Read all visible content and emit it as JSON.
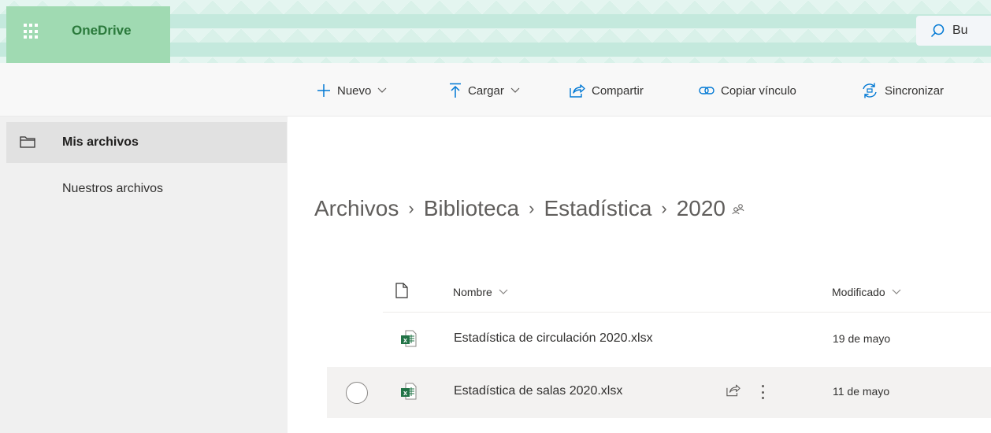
{
  "header": {
    "app_name": "OneDrive",
    "search_label": "Bu"
  },
  "toolbar": {
    "new_label": "Nuevo",
    "upload_label": "Cargar",
    "share_label": "Compartir",
    "copy_link_label": "Copiar vínculo",
    "sync_label": "Sincronizar"
  },
  "sidebar": {
    "items": [
      {
        "label": "Mis archivos",
        "icon": "folder-icon",
        "selected": true
      },
      {
        "label": "Nuestros archivos",
        "selected": false
      }
    ]
  },
  "breadcrumb": [
    "Archivos",
    "Biblioteca",
    "Estadística",
    "2020"
  ],
  "list": {
    "columns": {
      "name": "Nombre",
      "modified": "Modificado"
    },
    "rows": [
      {
        "name": "Estadística de circulación 2020.xlsx",
        "modified": "19 de mayo",
        "icon": "excel-file-icon"
      },
      {
        "name": "Estadística de salas 2020.xlsx",
        "modified": "11 de mayo",
        "icon": "excel-file-icon",
        "hovered": true
      }
    ]
  },
  "colors": {
    "accent": "#0078d4",
    "brand_green": "#2b7a3c",
    "banner": "#c4e9dd",
    "nav_background": "#f0f0f0",
    "nav_selected": "#e1e1e1",
    "excel_green": "#217346"
  }
}
